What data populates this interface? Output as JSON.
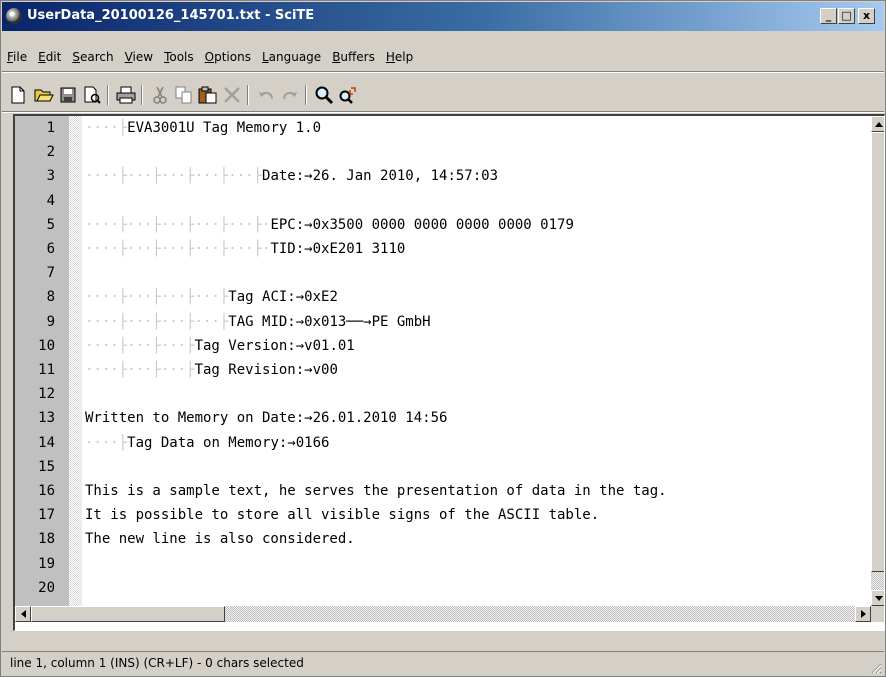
{
  "window": {
    "title": "UserData_20100126_145701.txt - SciTE",
    "minimize_glyph": "_",
    "maximize_glyph": "□",
    "close_glyph": "x"
  },
  "menu": [
    {
      "label": "File",
      "acc": "F",
      "rest": "ile"
    },
    {
      "label": "Edit",
      "acc": "E",
      "rest": "dit"
    },
    {
      "label": "Search",
      "acc": "S",
      "rest": "earch"
    },
    {
      "label": "View",
      "acc": "V",
      "rest": "iew"
    },
    {
      "label": "Tools",
      "acc": "T",
      "rest": "ools"
    },
    {
      "label": "Options",
      "acc": "O",
      "rest": "ptions"
    },
    {
      "label": "Language",
      "acc": "L",
      "rest": "anguage"
    },
    {
      "label": "Buffers",
      "acc": "B",
      "rest": "uffers"
    },
    {
      "label": "Help",
      "acc": "H",
      "rest": "elp"
    }
  ],
  "toolbar": {
    "icons": [
      "new-file-icon",
      "open-folder-icon",
      "save-icon",
      "close-file-icon",
      "print-icon",
      "cut-icon",
      "copy-icon",
      "paste-icon",
      "delete-icon",
      "undo-icon",
      "redo-icon",
      "find-icon",
      "replace-icon"
    ]
  },
  "editor": {
    "lines": [
      {
        "num": "1",
        "ws": "····├",
        "text": "EVA3001U Tag Memory 1.0"
      },
      {
        "num": "2",
        "ws": "",
        "text": ""
      },
      {
        "num": "3",
        "ws": "····├···├···├···├···├",
        "text": "Date:→26. Jan 2010, 14:57:03"
      },
      {
        "num": "4",
        "ws": "",
        "text": ""
      },
      {
        "num": "5",
        "ws": "····├···├···├···├···├·",
        "text": "EPC:→0x3500 0000 0000 0000 0000 0179"
      },
      {
        "num": "6",
        "ws": "····├···├···├···├···├·",
        "text": "TID:→0xE201 3110"
      },
      {
        "num": "7",
        "ws": "",
        "text": ""
      },
      {
        "num": "8",
        "ws": "····├···├···├···├",
        "text": "Tag ACI:→0xE2"
      },
      {
        "num": "9",
        "ws": "····├···├···├···├",
        "text": "TAG MID:→0x013──→PE GmbH"
      },
      {
        "num": "10",
        "ws": "····├···├···├",
        "text": "Tag Version:→v01.01"
      },
      {
        "num": "11",
        "ws": "····├···├···├",
        "text": "Tag Revision:→v00"
      },
      {
        "num": "12",
        "ws": "",
        "text": ""
      },
      {
        "num": "13",
        "ws": "",
        "text": "Written to Memory on Date:→26.01.2010 14:56"
      },
      {
        "num": "14",
        "ws": "····├",
        "text": "Tag Data on Memory:→0166"
      },
      {
        "num": "15",
        "ws": "",
        "text": ""
      },
      {
        "num": "16",
        "ws": "",
        "text": "This is a sample text, he serves the presentation of data in the tag."
      },
      {
        "num": "17",
        "ws": "",
        "text": "It is possible to store all visible signs of the ASCII table."
      },
      {
        "num": "18",
        "ws": "",
        "text": "The new line is also considered."
      },
      {
        "num": "19",
        "ws": "",
        "text": ""
      },
      {
        "num": "20",
        "ws": "",
        "text": ""
      }
    ]
  },
  "status": {
    "text": "line 1, column 1 (INS) (CR+LF) - 0 chars selected"
  }
}
